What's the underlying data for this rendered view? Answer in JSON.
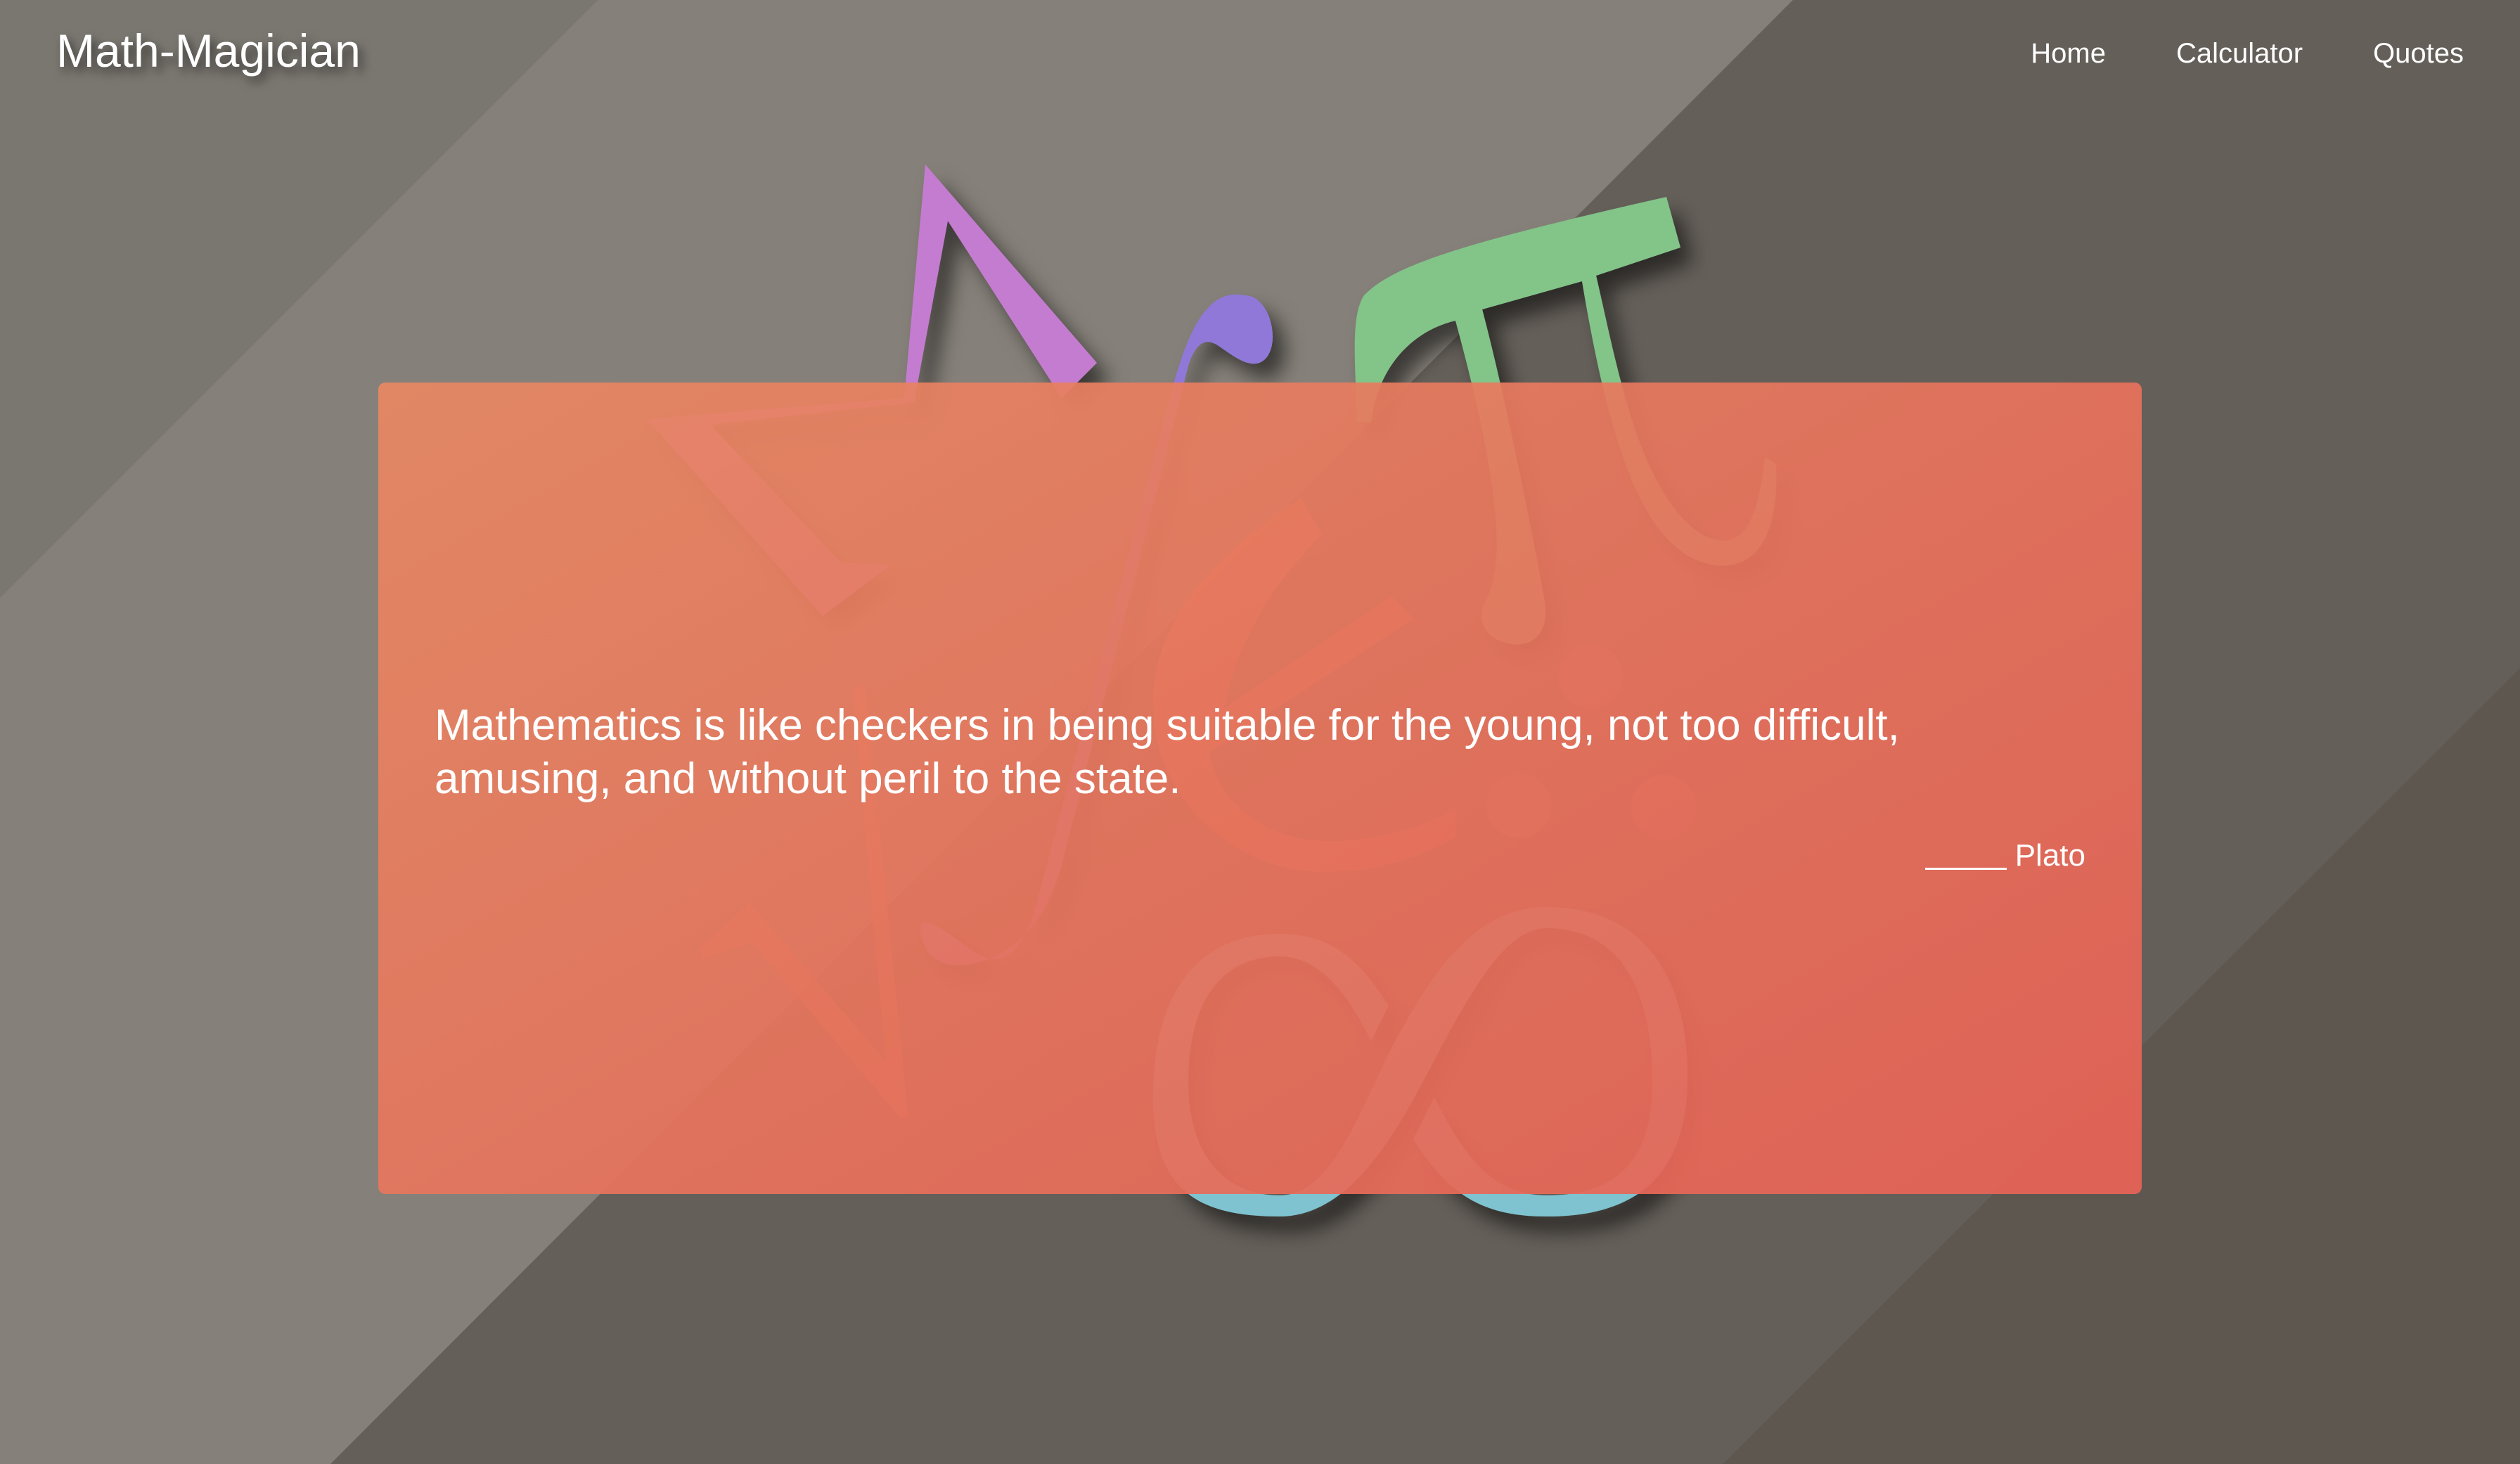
{
  "header": {
    "brand": "Math-Magician",
    "nav": [
      {
        "label": "Home"
      },
      {
        "label": "Calculator"
      },
      {
        "label": "Quotes"
      }
    ]
  },
  "quote": {
    "text": "Mathematics is like checkers in being suitable for the young, not too difficult, amusing, and without peril to the state.",
    "author_prefix": "_____",
    "author": "Plato"
  },
  "colors": {
    "background_light": "#85817a",
    "background_dark": "#625d57",
    "card": "#e5715d",
    "delta_symbol": "#c47bd0",
    "integral_symbol": "#9078d8",
    "pi_symbol": "#83c489",
    "infinity_symbol": "#7ec3cf",
    "text": "#ffffff"
  },
  "icons": [
    "delta-symbol-icon",
    "integral-symbol-icon",
    "element-of-symbol-icon",
    "pi-symbol-icon",
    "therefore-symbol-icon",
    "infinity-symbol-icon",
    "checkmark-symbol-icon"
  ]
}
